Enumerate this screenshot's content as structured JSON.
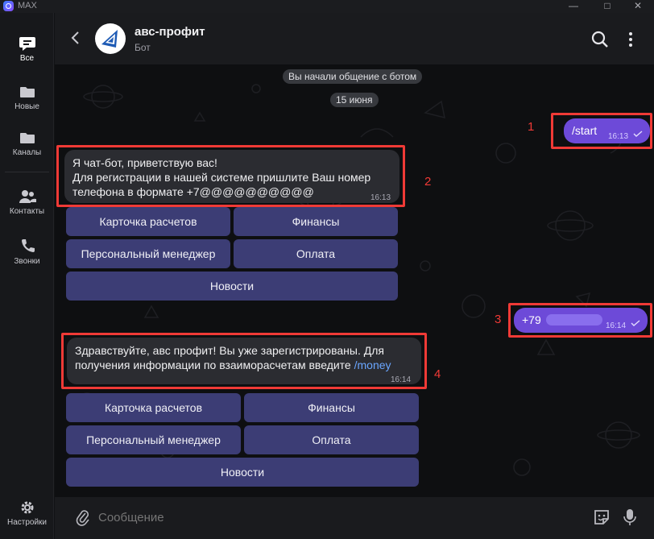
{
  "app": {
    "name": "MAX",
    "window_controls": [
      "minimize",
      "maximize",
      "close"
    ]
  },
  "sidebar": {
    "items": [
      {
        "label": "Все",
        "icon": "chat-bubble-icon",
        "active": true
      },
      {
        "label": "Новые",
        "icon": "folder-icon",
        "active": false
      },
      {
        "label": "Каналы",
        "icon": "folder-icon",
        "active": false
      },
      {
        "label": "Контакты",
        "icon": "contacts-icon",
        "active": false
      },
      {
        "label": "Звонки",
        "icon": "phone-icon",
        "active": false
      }
    ],
    "settings_label": "Настройки"
  },
  "header": {
    "title": "авс-профит",
    "subtitle": "Бот"
  },
  "chat": {
    "system_notice": "Вы начали общение с ботом",
    "date": "15 июня",
    "messages": [
      {
        "direction": "out",
        "text": "/start",
        "time": "16:13",
        "annotation": "1"
      },
      {
        "direction": "in",
        "lines": [
          "Я чат-бот, приветствую вас!",
          "Для регистрации в нашей системе пришлите Ваш номер",
          "телефона в формате +7@@@@@@@@@@"
        ],
        "time": "16:13",
        "annotation": "2"
      },
      {
        "direction": "out",
        "text": "+79",
        "time": "16:14",
        "annotation": "3"
      },
      {
        "direction": "in",
        "lines": [
          "Здравствуйте, авс профит! Вы уже зарегистрированы. Для",
          "получения информации по взаиморасчетам введите "
        ],
        "link": "/money",
        "time": "16:14",
        "annotation": "4"
      }
    ],
    "keyboard1": {
      "row1": [
        "Карточка расчетов",
        "Финансы"
      ],
      "row2": [
        "Персональный менеджер",
        "Оплата"
      ],
      "row3": [
        "Новости"
      ]
    },
    "keyboard2": {
      "row1": [
        "Карточка расчетов",
        "Финансы"
      ],
      "row2": [
        "Персональный менеджер",
        "Оплата"
      ],
      "row3": [
        "Новости"
      ]
    }
  },
  "composer": {
    "placeholder": "Сообщение"
  },
  "colors": {
    "accent": "#6d4ad8",
    "keyboard": "#3c3d75",
    "highlight": "#f03a36",
    "link": "#6aa6ff"
  }
}
